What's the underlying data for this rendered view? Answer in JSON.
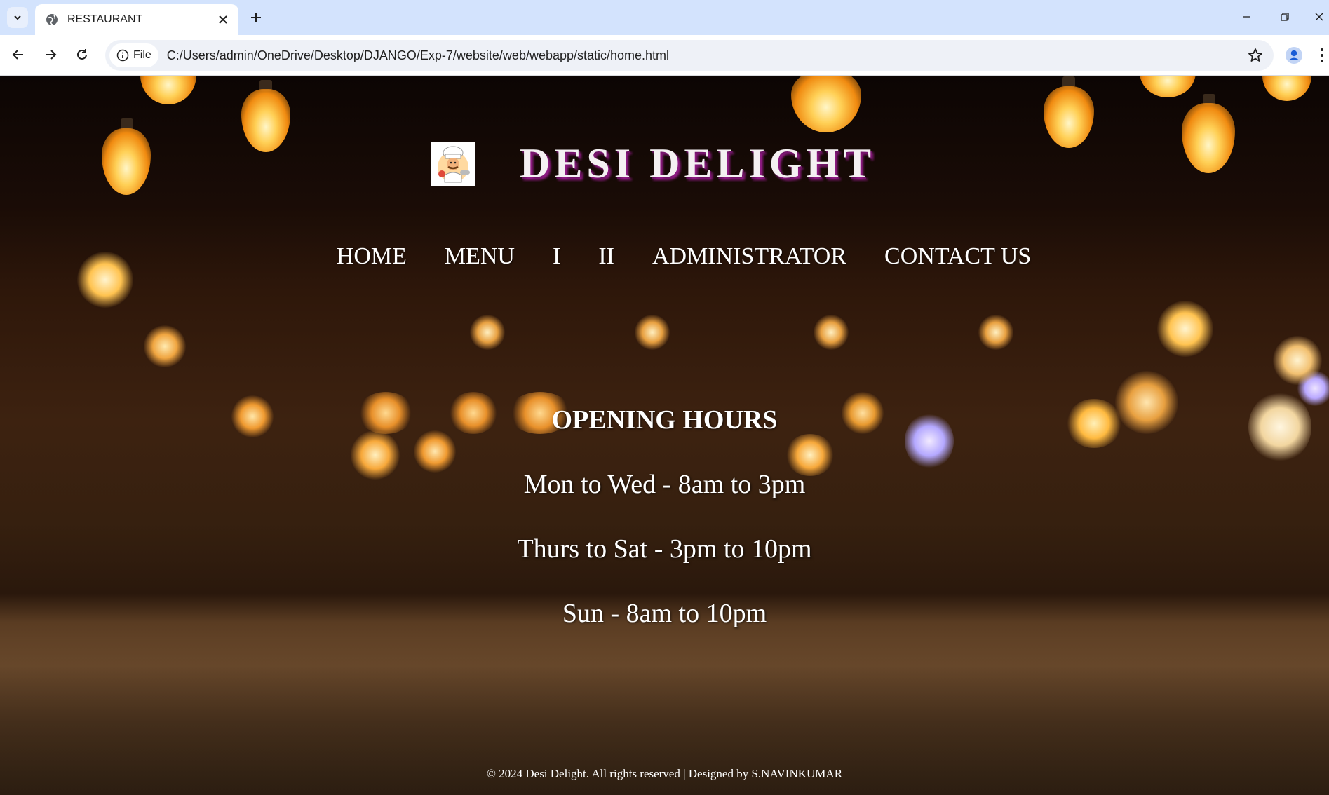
{
  "browser": {
    "tab_title": "RESTAURANT",
    "url_chip": "File",
    "url": "C:/Users/admin/OneDrive/Desktop/DJANGO/Exp-7/website/web/webapp/static/home.html"
  },
  "site": {
    "brand_title": "DESI DELIGHT",
    "nav": [
      "HOME",
      "MENU",
      "I",
      "II",
      "ADMINISTRATOR",
      "CONTACT US"
    ],
    "hours_heading": "OPENING HOURS",
    "hours": [
      "Mon to Wed - 8am to 3pm",
      "Thurs to Sat - 3pm to 10pm",
      "Sun - 8am to 10pm"
    ],
    "footer": "© 2024 Desi Delight. All rights reserved | Designed by S.NAVINKUMAR"
  },
  "icons": {
    "tab_favicon": "globe-icon",
    "logo": "chef-logo-icon"
  },
  "colors": {
    "tabbar_bg": "#d3e3fd",
    "title_shadow": "#8e1b83"
  }
}
